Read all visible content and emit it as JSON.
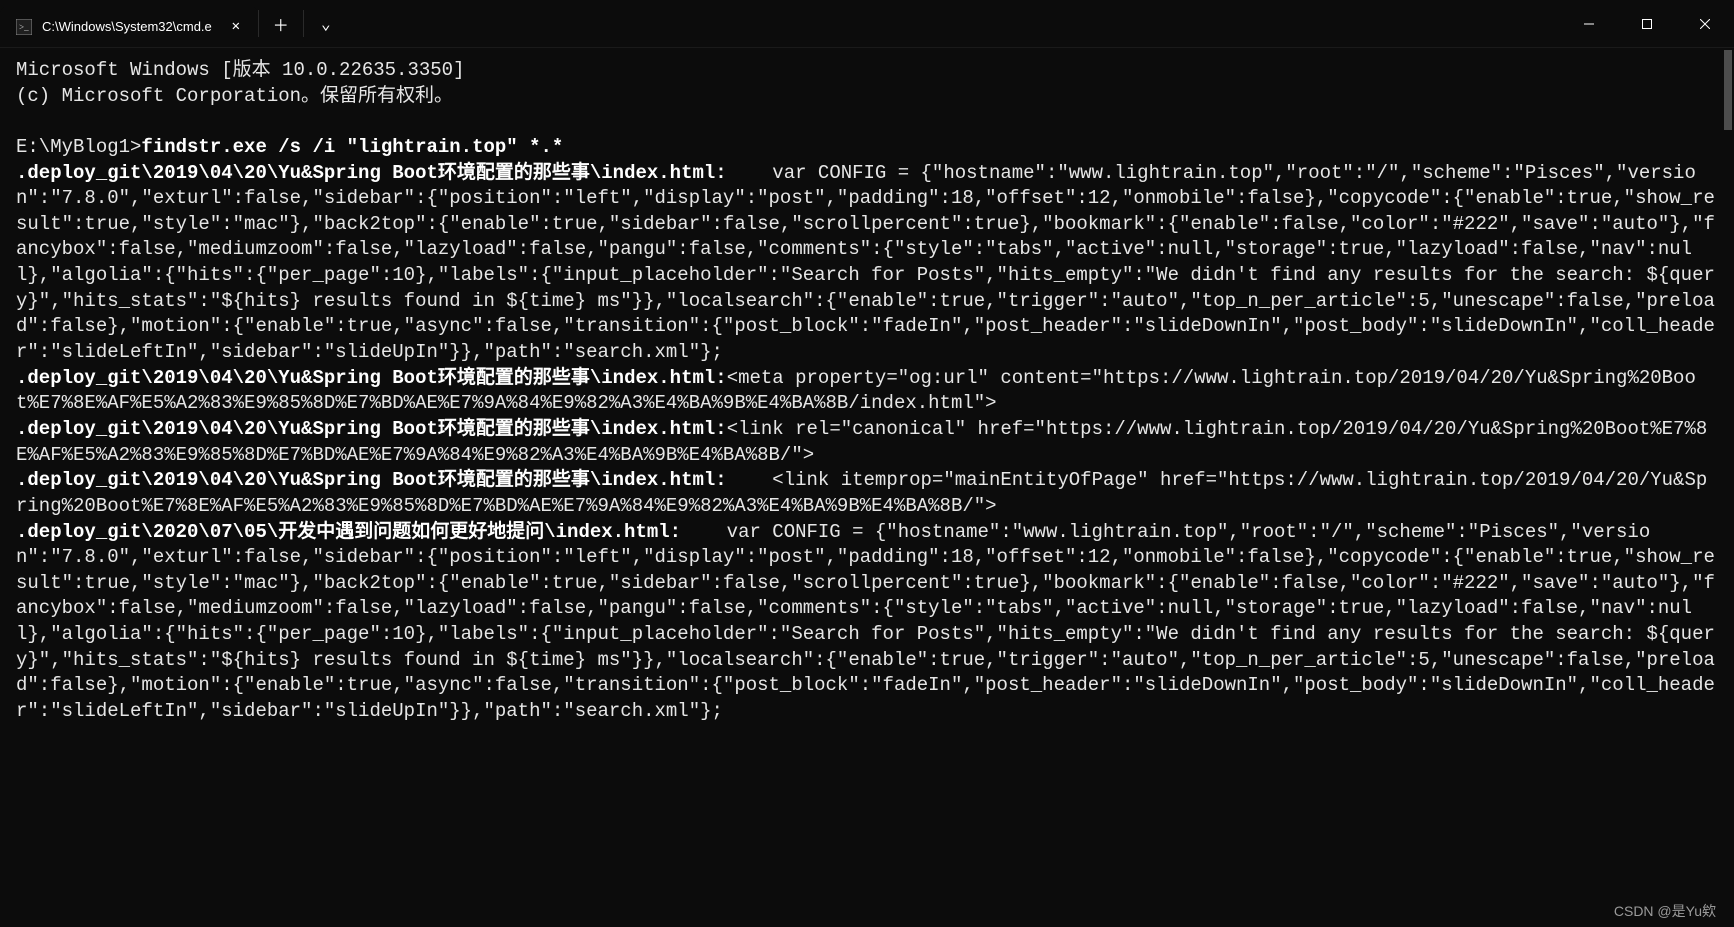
{
  "window": {
    "tab_title": "C:\\Windows\\System32\\cmd.e",
    "close_glyph": "✕",
    "plus_glyph": "＋",
    "chevron_glyph": "⌄",
    "min_glyph": "—",
    "max_glyph": "▢",
    "winclose_glyph": "✕"
  },
  "terminal": {
    "header_line1": "Microsoft Windows [版本 10.0.22635.3350]",
    "header_line2": "(c) Microsoft Corporation。保留所有权利。",
    "blank": "",
    "prompt": "E:\\MyBlog1>",
    "command": "findstr.exe /s /i \"lightrain.top\" *.*",
    "out1_path": ".deploy_git\\2019\\04\\20\\Yu&Spring Boot环境配置的那些事\\index.html:",
    "out1_body": "    var CONFIG = {\"hostname\":\"www.lightrain.top\",\"root\":\"/\",\"scheme\":\"Pisces\",\"version\":\"7.8.0\",\"exturl\":false,\"sidebar\":{\"position\":\"left\",\"display\":\"post\",\"padding\":18,\"offset\":12,\"onmobile\":false},\"copycode\":{\"enable\":true,\"show_result\":true,\"style\":\"mac\"},\"back2top\":{\"enable\":true,\"sidebar\":false,\"scrollpercent\":true},\"bookmark\":{\"enable\":false,\"color\":\"#222\",\"save\":\"auto\"},\"fancybox\":false,\"mediumzoom\":false,\"lazyload\":false,\"pangu\":false,\"comments\":{\"style\":\"tabs\",\"active\":null,\"storage\":true,\"lazyload\":false,\"nav\":null},\"algolia\":{\"hits\":{\"per_page\":10},\"labels\":{\"input_placeholder\":\"Search for Posts\",\"hits_empty\":\"We didn't find any results for the search: ${query}\",\"hits_stats\":\"${hits} results found in ${time} ms\"}},\"localsearch\":{\"enable\":true,\"trigger\":\"auto\",\"top_n_per_article\":5,\"unescape\":false,\"preload\":false},\"motion\":{\"enable\":true,\"async\":false,\"transition\":{\"post_block\":\"fadeIn\",\"post_header\":\"slideDownIn\",\"post_body\":\"slideDownIn\",\"coll_header\":\"slideLeftIn\",\"sidebar\":\"slideUpIn\"}},\"path\":\"search.xml\"};",
    "out2_path": ".deploy_git\\2019\\04\\20\\Yu&Spring Boot环境配置的那些事\\index.html:",
    "out2_body": "<meta property=\"og:url\" content=\"https://www.lightrain.top/2019/04/20/Yu&Spring%20Boot%E7%8E%AF%E5%A2%83%E9%85%8D%E7%BD%AE%E7%9A%84%E9%82%A3%E4%BA%9B%E4%BA%8B/index.html\">",
    "out3_path": ".deploy_git\\2019\\04\\20\\Yu&Spring Boot环境配置的那些事\\index.html:",
    "out3_body": "<link rel=\"canonical\" href=\"https://www.lightrain.top/2019/04/20/Yu&Spring%20Boot%E7%8E%AF%E5%A2%83%E9%85%8D%E7%BD%AE%E7%9A%84%E9%82%A3%E4%BA%9B%E4%BA%8B/\">",
    "out4_path": ".deploy_git\\2019\\04\\20\\Yu&Spring Boot环境配置的那些事\\index.html:",
    "out4_body": "    <link itemprop=\"mainEntityOfPage\" href=\"https://www.lightrain.top/2019/04/20/Yu&Spring%20Boot%E7%8E%AF%E5%A2%83%E9%85%8D%E7%BD%AE%E7%9A%84%E9%82%A3%E4%BA%9B%E4%BA%8B/\">",
    "out5_path": ".deploy_git\\2020\\07\\05\\开发中遇到问题如何更好地提问\\index.html:",
    "out5_body": "    var CONFIG = {\"hostname\":\"www.lightrain.top\",\"root\":\"/\",\"scheme\":\"Pisces\",\"version\":\"7.8.0\",\"exturl\":false,\"sidebar\":{\"position\":\"left\",\"display\":\"post\",\"padding\":18,\"offset\":12,\"onmobile\":false},\"copycode\":{\"enable\":true,\"show_result\":true,\"style\":\"mac\"},\"back2top\":{\"enable\":true,\"sidebar\":false,\"scrollpercent\":true},\"bookmark\":{\"enable\":false,\"color\":\"#222\",\"save\":\"auto\"},\"fancybox\":false,\"mediumzoom\":false,\"lazyload\":false,\"pangu\":false,\"comments\":{\"style\":\"tabs\",\"active\":null,\"storage\":true,\"lazyload\":false,\"nav\":null},\"algolia\":{\"hits\":{\"per_page\":10},\"labels\":{\"input_placeholder\":\"Search for Posts\",\"hits_empty\":\"We didn't find any results for the search: ${query}\",\"hits_stats\":\"${hits} results found in ${time} ms\"}},\"localsearch\":{\"enable\":true,\"trigger\":\"auto\",\"top_n_per_article\":5,\"unescape\":false,\"preload\":false},\"motion\":{\"enable\":true,\"async\":false,\"transition\":{\"post_block\":\"fadeIn\",\"post_header\":\"slideDownIn\",\"post_body\":\"slideDownIn\",\"coll_header\":\"slideLeftIn\",\"sidebar\":\"slideUpIn\"}},\"path\":\"search.xml\"};"
  },
  "watermark": "CSDN @是Yu欸"
}
